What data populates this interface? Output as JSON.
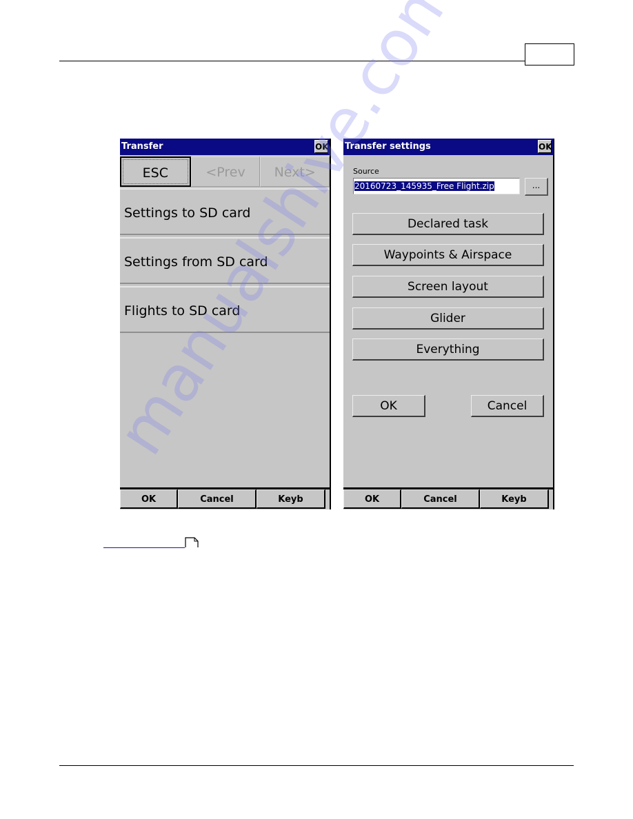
{
  "document": {
    "page_number_box": "",
    "watermark": "manualshive.com"
  },
  "left_window": {
    "title": "Transfer",
    "title_ok": "OK",
    "nav": {
      "esc": "ESC",
      "prev": "<Prev",
      "next": "Next>"
    },
    "items": [
      {
        "label": "Settings to SD card"
      },
      {
        "label": "Settings from SD card"
      },
      {
        "label": "Flights to SD card"
      }
    ],
    "bottom": {
      "ok": "OK",
      "cancel": "Cancel",
      "keyb": "Keyb"
    }
  },
  "right_window": {
    "title": "Transfer settings",
    "title_ok": "OK",
    "source_label": "Source",
    "source_value": "20160723_145935_Free Flight.zip",
    "browse_label": "...",
    "options": [
      {
        "label": "Declared task"
      },
      {
        "label": "Waypoints & Airspace"
      },
      {
        "label": "Screen layout"
      },
      {
        "label": "Glider"
      },
      {
        "label": "Everything"
      }
    ],
    "ok_label": "OK",
    "cancel_label": "Cancel",
    "bottom": {
      "ok": "OK",
      "cancel": "Cancel",
      "keyb": "Keyb"
    }
  },
  "colors": {
    "titlebar": "#0a0a84",
    "window_bg": "#c6c6c6",
    "selection": "#0a0a84"
  }
}
